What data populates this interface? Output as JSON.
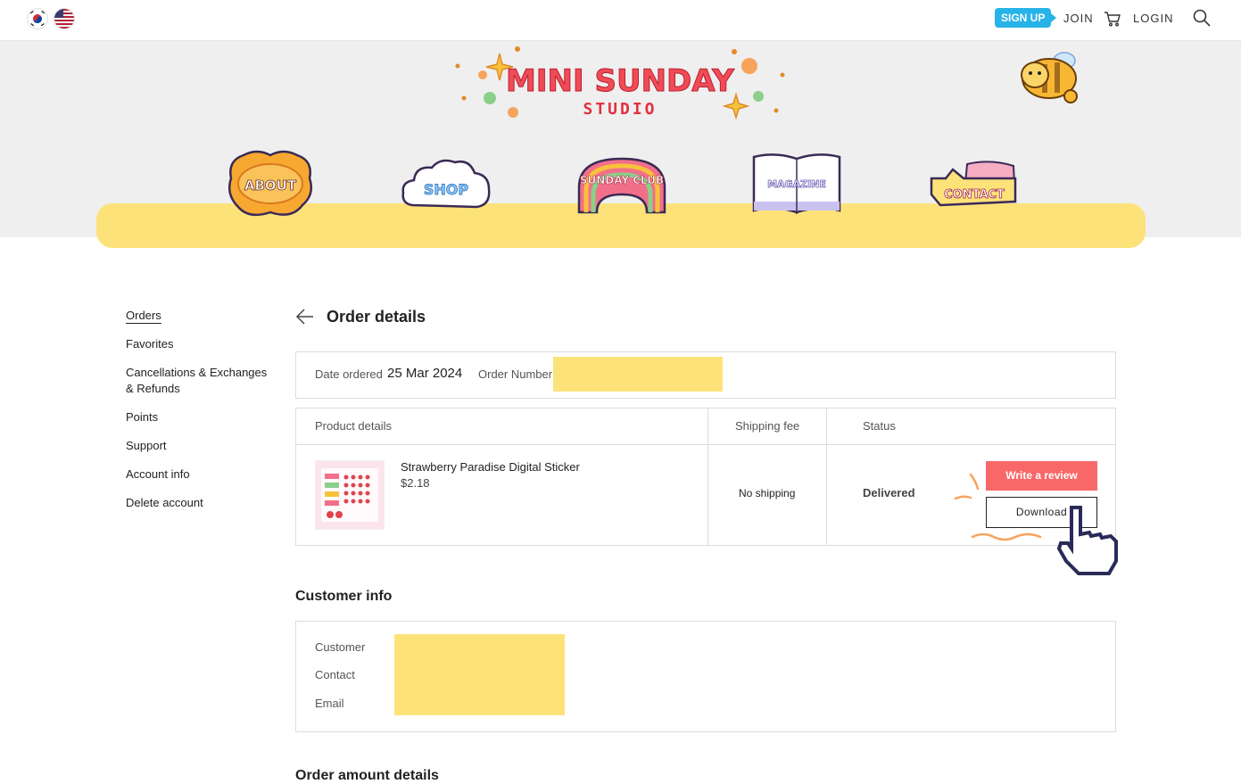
{
  "topbar": {
    "signup_badge": "SIGN UP",
    "join": "JOIN",
    "login": "LOGIN"
  },
  "header": {
    "logo_line1": "MINI SUNDAY",
    "logo_line2": "STUDIO",
    "nav": [
      {
        "label": "ABOUT"
      },
      {
        "label": "SHOP"
      },
      {
        "label": "SUNDAY CLUB"
      },
      {
        "label": "MAGAZINE"
      },
      {
        "label": "CONTACT"
      }
    ]
  },
  "sidebar": {
    "items": [
      {
        "label": "Orders"
      },
      {
        "label": "Favorites"
      },
      {
        "label": "Cancellations & Exchanges & Refunds"
      },
      {
        "label": "Points"
      },
      {
        "label": "Support"
      },
      {
        "label": "Account info"
      },
      {
        "label": "Delete account"
      }
    ]
  },
  "order": {
    "title": "Order details",
    "date_label": "Date ordered",
    "date_value": "25 Mar 2024",
    "number_label": "Order Number",
    "table": {
      "col_product": "Product details",
      "col_shipping": "Shipping fee",
      "col_status": "Status",
      "product_name": "Strawberry Paradise Digital Sticker",
      "product_price": "$2.18",
      "shipping": "No shipping",
      "status": "Delivered",
      "review_button": "Write a review",
      "download_button": "Download"
    }
  },
  "customer": {
    "title": "Customer info",
    "customer_label": "Customer",
    "contact_label": "Contact",
    "email_label": "Email"
  },
  "amount": {
    "title": "Order amount details"
  },
  "colors": {
    "accent_yellow": "#fde27a",
    "review_red": "#f96868",
    "signup_blue": "#27b3e8"
  }
}
